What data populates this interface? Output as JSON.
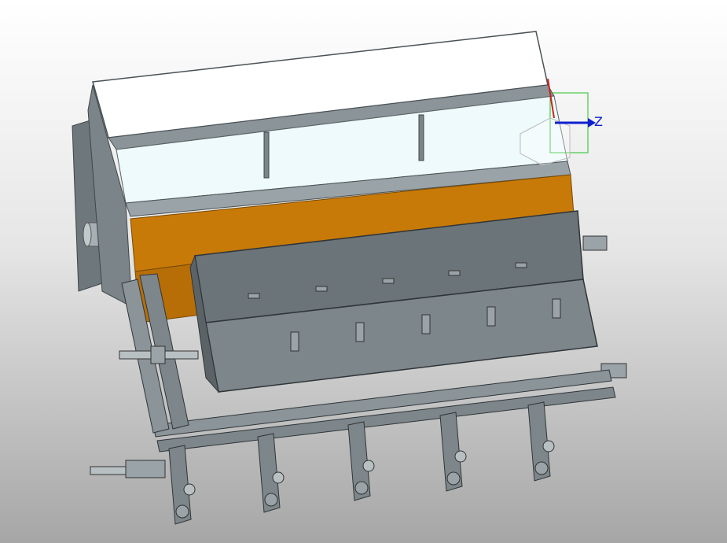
{
  "viewport": {
    "background_top": "#ffffff",
    "background_bottom": "#a6a6a6"
  },
  "model": {
    "steel_color": "#6b7478",
    "steel_light": "#9aa3a7",
    "steel_dark": "#4a5256",
    "glass_color": "#eefafb",
    "accent_color": "#c87a08",
    "bracket_count": 5
  },
  "triad": {
    "z_label": "Z",
    "z_color": "#1020d0",
    "x_color": "#d02020",
    "box_color": "#20c020"
  }
}
